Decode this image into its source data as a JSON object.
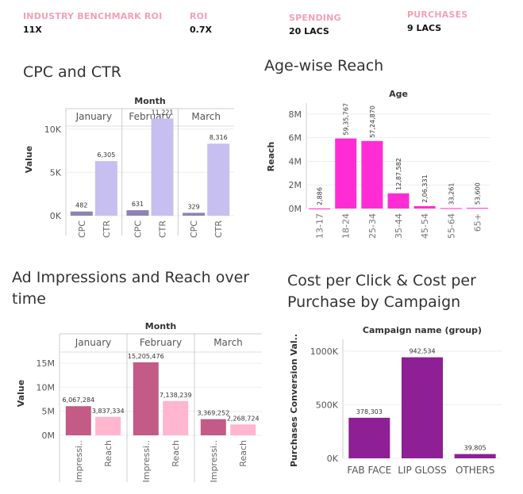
{
  "kpis": [
    {
      "label": "INDUSTRY BENCHMARK ROI",
      "value": "11X"
    },
    {
      "label": "ROI",
      "value": "0.7X"
    },
    {
      "label": "SPENDING",
      "value": "20 LACS"
    },
    {
      "label": "PURCHASES",
      "value": "9 LACS"
    }
  ],
  "chart_data": [
    {
      "type": "bar",
      "title": "CPC and CTR",
      "column_header": "Month",
      "groups": [
        "January",
        "February",
        "March"
      ],
      "categories": [
        "CPC",
        "CTR"
      ],
      "values": [
        [
          482,
          6305
        ],
        [
          631,
          11221
        ],
        [
          329,
          8316
        ]
      ],
      "data_labels": [
        [
          "482",
          "6,305"
        ],
        [
          "631",
          "11,221"
        ],
        [
          "329",
          "8,316"
        ]
      ],
      "ylabel": "Value",
      "yticks": [
        "0K",
        "5K",
        "10K"
      ],
      "ylim": [
        0,
        13000
      ],
      "colors": {
        "CPC": "#8e82b6",
        "CTR": "#c6bff0"
      }
    },
    {
      "type": "bar",
      "title": "Age-wise Reach",
      "column_header": "Age",
      "categories": [
        "13-17",
        "18-24",
        "25-34",
        "35-44",
        "45-54",
        "55-64",
        "65+"
      ],
      "values": [
        2886,
        5935767,
        5724870,
        1287582,
        206331,
        33261,
        53600
      ],
      "data_labels": [
        "2,886",
        "59,35,767",
        "57,24,870",
        "12,87,582",
        "2,06,331",
        "33,261",
        "53,600"
      ],
      "ylabel": "Reach",
      "yticks": [
        "0M",
        "2M",
        "4M",
        "6M",
        "8M"
      ],
      "ylim": [
        0,
        8800000
      ],
      "color": "#ff2cd6"
    },
    {
      "type": "bar",
      "title": "Ad Impressions and Reach over time",
      "column_header": "Month",
      "groups": [
        "January",
        "February",
        "March"
      ],
      "categories": [
        "Impressi..",
        "Reach"
      ],
      "values": [
        [
          6067284,
          3837334
        ],
        [
          15205476,
          7138239
        ],
        [
          3369252,
          2268724
        ]
      ],
      "data_labels": [
        [
          "6,067,284",
          "3,837,334"
        ],
        [
          "15,205,476",
          "7,138,239"
        ],
        [
          "3,369,252",
          "2,268,724"
        ]
      ],
      "ylabel": "Value",
      "yticks": [
        "0M",
        "5M",
        "10M",
        "15M"
      ],
      "ylim": [
        0,
        17500000
      ],
      "colors": {
        "Impressions": "#c35b86",
        "Reach": "#ffb6ce"
      }
    },
    {
      "type": "bar",
      "title": "Cost per Click & Cost per Purchase by Campaign",
      "column_header": "Campaign name (group)",
      "categories": [
        "FAB FACE",
        "LIP GLOSS",
        "OTHERS"
      ],
      "values": [
        378303,
        942534,
        39805
      ],
      "data_labels": [
        "378,303",
        "942,534",
        "39,805"
      ],
      "ylabel": "Purchases Conversion Val..",
      "yticks": [
        "0K",
        "500K",
        "1000K"
      ],
      "ylim": [
        0,
        1080000
      ],
      "color": "#8e1f94"
    }
  ]
}
